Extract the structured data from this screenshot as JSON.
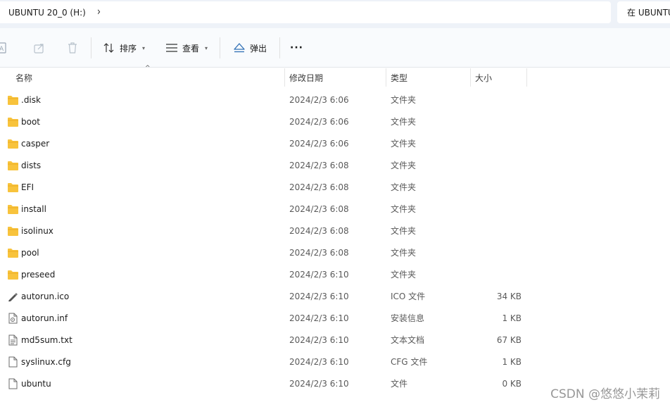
{
  "address": {
    "crumb": "UBUNTU 20_0 (H:)",
    "chevron": "›"
  },
  "search": {
    "placeholder": "在 UBUNTU"
  },
  "toolbar": {
    "sort_label": "排序",
    "view_label": "查看",
    "eject_label": "弹出",
    "more_label": "···"
  },
  "columns": {
    "name": "名称",
    "modified": "修改日期",
    "type": "类型",
    "size": "大小"
  },
  "files": [
    {
      "name": ".disk",
      "date": "2024/2/3 6:06",
      "type": "文件夹",
      "size": "",
      "icon": "folder-icon"
    },
    {
      "name": "boot",
      "date": "2024/2/3 6:06",
      "type": "文件夹",
      "size": "",
      "icon": "folder-icon"
    },
    {
      "name": "casper",
      "date": "2024/2/3 6:06",
      "type": "文件夹",
      "size": "",
      "icon": "folder-icon"
    },
    {
      "name": "dists",
      "date": "2024/2/3 6:08",
      "type": "文件夹",
      "size": "",
      "icon": "folder-icon"
    },
    {
      "name": "EFI",
      "date": "2024/2/3 6:08",
      "type": "文件夹",
      "size": "",
      "icon": "folder-icon"
    },
    {
      "name": "install",
      "date": "2024/2/3 6:08",
      "type": "文件夹",
      "size": "",
      "icon": "folder-icon"
    },
    {
      "name": "isolinux",
      "date": "2024/2/3 6:08",
      "type": "文件夹",
      "size": "",
      "icon": "folder-icon"
    },
    {
      "name": "pool",
      "date": "2024/2/3 6:08",
      "type": "文件夹",
      "size": "",
      "icon": "folder-icon"
    },
    {
      "name": "preseed",
      "date": "2024/2/3 6:10",
      "type": "文件夹",
      "size": "",
      "icon": "folder-icon"
    },
    {
      "name": "autorun.ico",
      "date": "2024/2/3 6:10",
      "type": "ICO 文件",
      "size": "34 KB",
      "icon": "ico-file-icon"
    },
    {
      "name": "autorun.inf",
      "date": "2024/2/3 6:10",
      "type": "安装信息",
      "size": "1 KB",
      "icon": "inf-file-icon"
    },
    {
      "name": "md5sum.txt",
      "date": "2024/2/3 6:10",
      "type": "文本文档",
      "size": "67 KB",
      "icon": "text-file-icon"
    },
    {
      "name": "syslinux.cfg",
      "date": "2024/2/3 6:10",
      "type": "CFG 文件",
      "size": "1 KB",
      "icon": "file-icon"
    },
    {
      "name": "ubuntu",
      "date": "2024/2/3 6:10",
      "type": "文件",
      "size": "0 KB",
      "icon": "file-icon"
    }
  ],
  "watermark": "CSDN @悠悠小茉莉",
  "colors": {
    "folder": "#f8c33c",
    "accent": "#2f6fb5"
  }
}
